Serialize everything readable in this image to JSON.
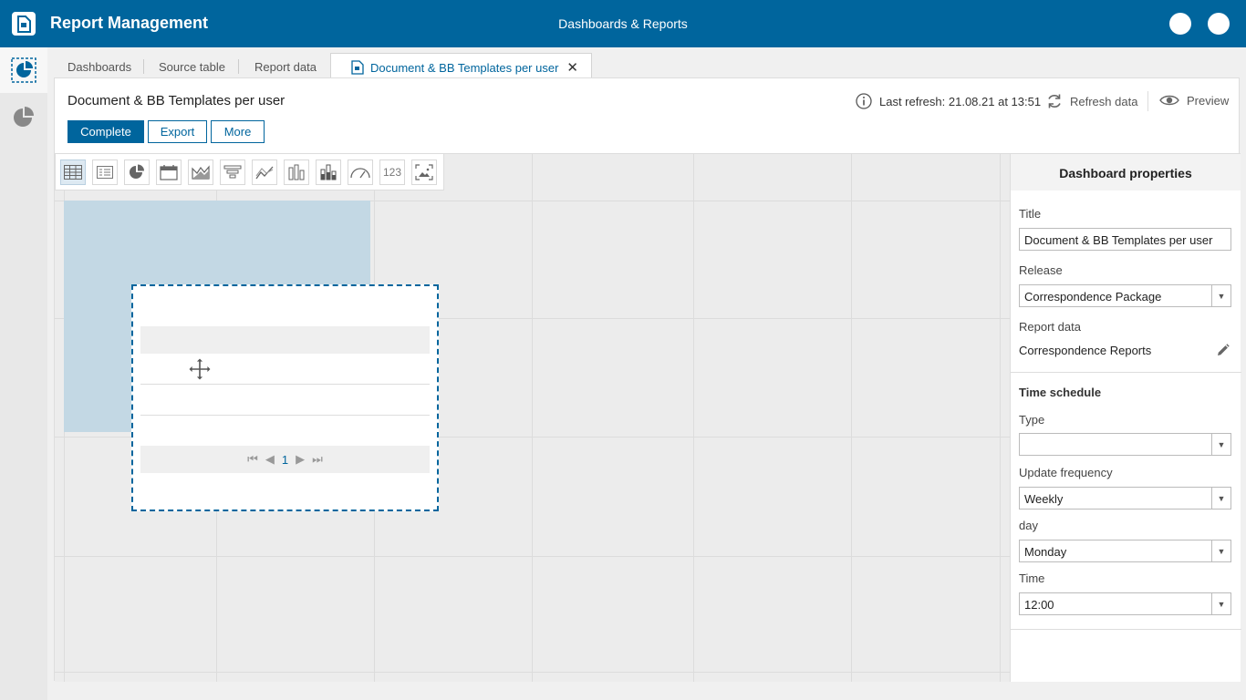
{
  "header": {
    "app_title": "Report Management",
    "center_title": "Dashboards & Reports"
  },
  "tabs": [
    {
      "label": "Dashboards"
    },
    {
      "label": "Source table"
    },
    {
      "label": "Report data"
    },
    {
      "label": "Document & BB Templates per user",
      "active": true,
      "close_symbol": "✕"
    }
  ],
  "page": {
    "title": "Document & BB Templates per user",
    "buttons": {
      "complete": "Complete",
      "export": "Export",
      "more": "More"
    },
    "last_refresh": "Last refresh: 21.08.21 at 13:51",
    "refresh_label": "Refresh data",
    "preview_label": "Preview"
  },
  "toolbox": {
    "tools": [
      "table-icon",
      "card-list-icon",
      "pie-chart-icon",
      "calendar-icon",
      "area-chart-icon",
      "funnel-icon",
      "line-chart-icon",
      "bar-chart-icon",
      "stacked-bar-icon",
      "gauge-icon",
      "number-icon",
      "image-icon"
    ],
    "number_label": "123"
  },
  "widget": {
    "pager_page": "1"
  },
  "properties": {
    "heading": "Dashboard properties",
    "title_label": "Title",
    "title_value": "Document & BB Templates per user",
    "release_label": "Release",
    "release_value": "Correspondence Package",
    "report_data_label": "Report data",
    "report_data_value": "Correspondence Reports",
    "schedule_heading": "Time schedule",
    "type_label": "Type",
    "type_value": "",
    "frequency_label": "Update frequency",
    "frequency_value": "Weekly",
    "day_label": "day",
    "day_value": "Monday",
    "time_label": "Time",
    "time_value": "12:00"
  },
  "colors": {
    "brand": "#00659d",
    "selection": "#c3d8e4"
  }
}
